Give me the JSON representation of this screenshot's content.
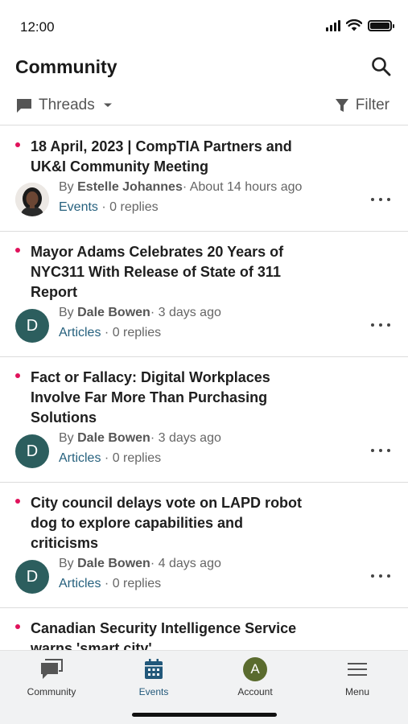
{
  "status": {
    "time": "12:00"
  },
  "header": {
    "title": "Community",
    "search_icon": "search-icon"
  },
  "filters": {
    "threads_label": "Threads",
    "filter_label": "Filter"
  },
  "posts": [
    {
      "title": "18 April, 2023 | CompTIA Partners and UK&I Community Meeting",
      "by": "By",
      "author": "Estelle Johannes",
      "time": "About 14 hours ago",
      "category": "Events",
      "replies": "0 replies",
      "avatar_type": "photo",
      "avatar_letter": ""
    },
    {
      "title": "Mayor Adams Celebrates 20 Years of NYC311 With Release of State of 311 Report",
      "by": "By",
      "author": "Dale Bowen",
      "time": "3 days ago",
      "category": "Articles",
      "replies": "0 replies",
      "avatar_type": "letter",
      "avatar_letter": "D"
    },
    {
      "title": "Fact or Fallacy: Digital Workplaces Involve Far More Than Purchasing Solutions",
      "by": "By",
      "author": "Dale Bowen",
      "time": "3 days ago",
      "category": "Articles",
      "replies": "0 replies",
      "avatar_type": "letter",
      "avatar_letter": "D"
    },
    {
      "title": "City council delays vote on LAPD robot dog to explore capabilities and criticisms",
      "by": "By",
      "author": "Dale Bowen",
      "time": "4 days ago",
      "category": "Articles",
      "replies": "0 replies",
      "avatar_type": "letter",
      "avatar_letter": "D"
    },
    {
      "title": "Canadian Security Intelligence Service warns 'smart city'",
      "by": "",
      "author": "",
      "time": "",
      "category": "",
      "replies": "",
      "avatar_type": "none",
      "avatar_letter": ""
    }
  ],
  "tabs": [
    {
      "label": "Community",
      "icon": "chat-bubble-icon"
    },
    {
      "label": "Events",
      "icon": "calendar-icon",
      "active": true
    },
    {
      "label": "Account",
      "icon": "account-avatar",
      "letter": "A"
    },
    {
      "label": "Menu",
      "icon": "hamburger-menu-icon"
    }
  ],
  "colors": {
    "unread_dot": "#e0125b",
    "link": "#25607d",
    "active_tab": "#22587a",
    "avatar_bg": "#2c5e5e",
    "account_avatar_bg": "#5a6b2e"
  }
}
